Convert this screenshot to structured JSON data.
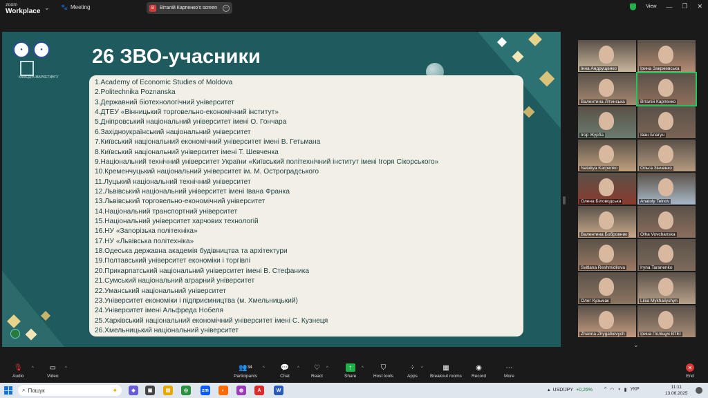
{
  "topbar": {
    "brand_line1": "zoom",
    "brand_line2": "Workplace",
    "meeting_label": "Meeting",
    "share_label": "Віталій Карпенко's screen",
    "view_label": "View"
  },
  "slide": {
    "title": "26 ЗВО-учасники",
    "logo_text": "КАФЕДРА МАРКЕТИНГУ",
    "items": [
      "1.Academy of Economic Studies of Moldova",
      "2.Politechnika Poznanska",
      "3.Державний біотехнологічний університет",
      "4.ДТЕУ «Вінницький торговельно-економічний інститут»",
      "5.Дніпровський національний університет імені О. Гончара",
      "6.Західноукраїнський національний університет",
      "7.Київський національний економічний університет імені В. Гетьмана",
      "8.Київський національний університет імені Т. Шевченка",
      "9.Національний технічний університет України «Київський політехнічний інститут імені Ігоря Сікорського»",
      "10.Кременчуцький національний університет ім. М. Остроградського",
      "11.Луцький національний технічний університет",
      "12.Львівський національний університет імені Івана Франка",
      "13.Львівський торговельно-економічний університет",
      "14.Національний транспортний університет",
      "15.Національний університет харчових технологій",
      "16.НУ «Запорізька політехніка»",
      "17.НУ «Львівська політехніка»",
      "18.Одеська державна академія будівництва та архітектури",
      "19.Полтавський університет економіки і торгівлі",
      "20.Прикарпатський національний університет імені В. Стефаника",
      "21.Сумський національний аграрний університет",
      "22.Уманський національний університет",
      "23.Університет економіки і підприємництва (м. Хмельницький)",
      "24.Університет імені Альфреда Нобеля",
      "25.Харківський національний економічний університет імені С. Кузнеця",
      "26.Хмельницький національний університет"
    ]
  },
  "participants": [
    {
      "name": "Інна Андрущенко",
      "color": "#c9b79c"
    },
    {
      "name": "Ірина Закржевська",
      "color": "#b48c74"
    },
    {
      "name": "Валентина Літинська",
      "color": "#a58a72"
    },
    {
      "name": "Віталій Карпенко",
      "color": "#8f6f5c"
    },
    {
      "name": "Ігор Журба",
      "color": "#6b7c6e"
    },
    {
      "name": "Іван Благун",
      "color": "#7b6456"
    },
    {
      "name": "Nataliya Karpenko",
      "color": "#c0a07e"
    },
    {
      "name": "Ольга Зінченко",
      "color": "#b59a80"
    },
    {
      "name": "Олена Біловодська",
      "color": "#8a3b2f"
    },
    {
      "name": "Anatoly Telnov",
      "color": "#a9b8c8"
    },
    {
      "name": "Валентина Бобровник",
      "color": "#caa98c"
    },
    {
      "name": "Olha Vovchanska",
      "color": "#8b6e5e"
    },
    {
      "name": "Svitlana Reshmidilova",
      "color": "#9c7a63"
    },
    {
      "name": "Iryna Taranenko",
      "color": "#7d6a5c"
    },
    {
      "name": "Олег Кузьмак",
      "color": "#8c7560"
    },
    {
      "name": "Liliia Mykhailyshyn",
      "color": "#b7a089"
    },
    {
      "name": "Zhanna Zhygalkevych",
      "color": "#c49a7f"
    },
    {
      "name": "Ірина Поліщук ВТЕІ",
      "color": "#a88c76"
    }
  ],
  "toolbar": {
    "audio": "Audio",
    "video": "Video",
    "participants": "Participants",
    "participants_count": "34",
    "chat": "Chat",
    "react": "React",
    "share": "Share",
    "host_tools": "Host tools",
    "apps": "Apps",
    "breakout": "Breakout rooms",
    "record": "Record",
    "more": "More",
    "end": "End"
  },
  "taskbar": {
    "search_placeholder": "Пошук",
    "ticker_symbol": "USD/JPY",
    "ticker_change": "+0,26%",
    "lang": "УКР",
    "time": "11:11",
    "date": "13.06.2025"
  }
}
